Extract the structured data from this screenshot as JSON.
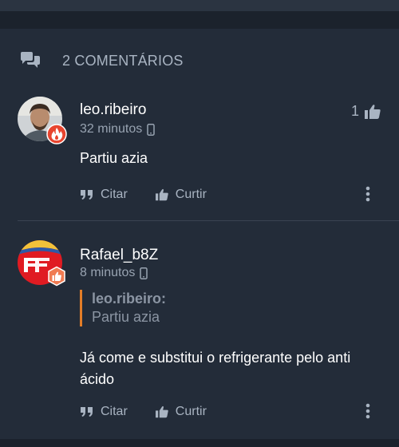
{
  "header": {
    "title": "2 COMENTÁRIOS",
    "icon": "comments-icon"
  },
  "comments": [
    {
      "username": "leo.ribeiro",
      "time": "32 minutos",
      "likes": "1",
      "badge": "fire-badge",
      "text": "Partiu azia",
      "actions": {
        "quote": "Citar",
        "like": "Curtir"
      }
    },
    {
      "username": "Rafael_b8Z",
      "time": "8 minutos",
      "badge": "thumbs-up-badge",
      "quote": {
        "user": "leo.ribeiro:",
        "text": "Partiu azia"
      },
      "text": "Já come e substitui o refrigerante pelo anti ácido",
      "actions": {
        "quote": "Citar",
        "like": "Curtir"
      }
    }
  ],
  "colors": {
    "background": "#232c39",
    "accent_quote": "#e37d28",
    "badge_red": "#e8452f",
    "badge_orange": "#f07b52"
  }
}
